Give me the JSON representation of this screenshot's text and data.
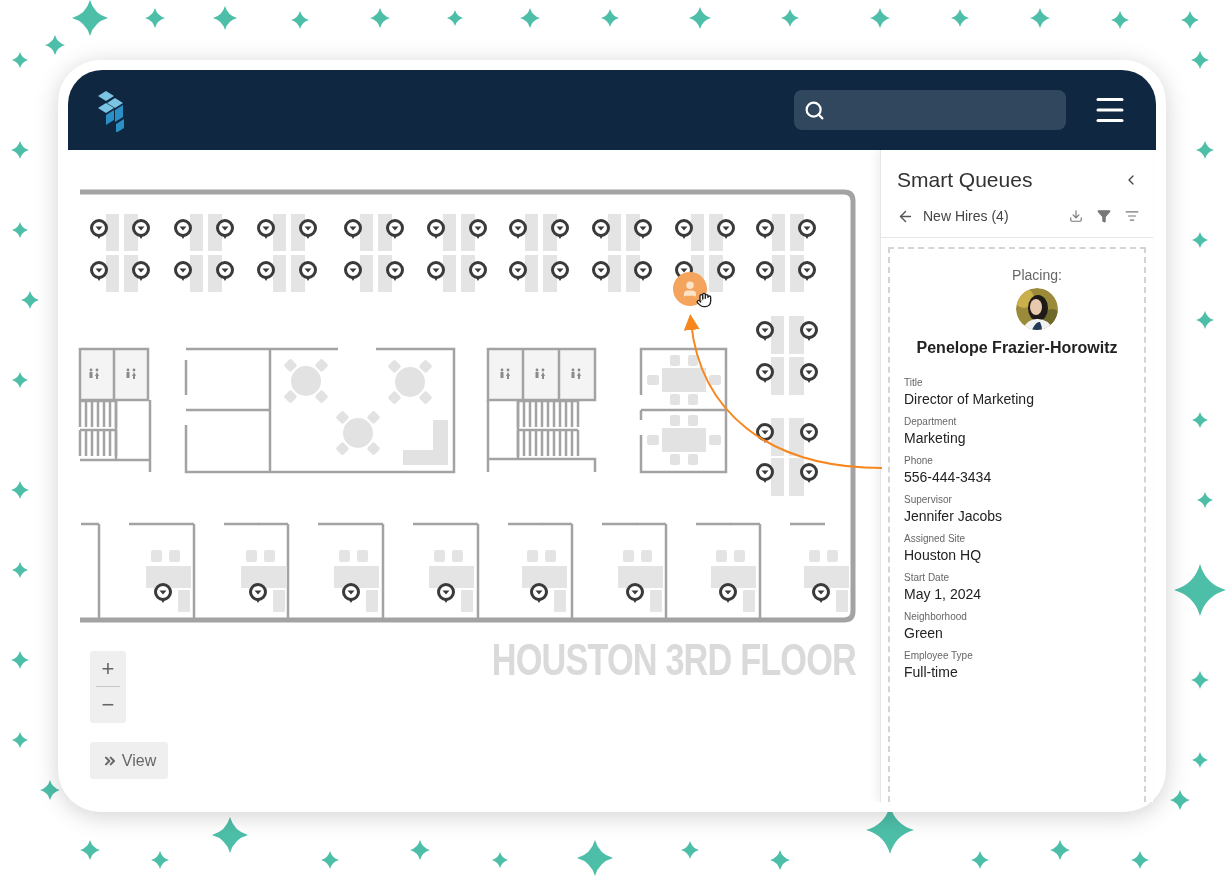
{
  "map": {
    "floor_label": "HOUSTON 3RD FLOOR",
    "zoom_in": "+",
    "zoom_out": "−",
    "view_button": "View"
  },
  "panel": {
    "title": "Smart Queues",
    "queue": "New Hires (4)",
    "placing": {
      "label": "Placing:",
      "name": "Penelope Frazier-Horowitz",
      "fields": [
        {
          "label": "Title",
          "value": "Director of Marketing"
        },
        {
          "label": "Department",
          "value": "Marketing"
        },
        {
          "label": "Phone",
          "value": "556-444-3434"
        },
        {
          "label": "Supervisor",
          "value": "Jennifer Jacobs"
        },
        {
          "label": "Assigned Site",
          "value": "Houston HQ"
        },
        {
          "label": "Start Date",
          "value": "May 1, 2024"
        },
        {
          "label": "Neighborhood",
          "value": "Green"
        },
        {
          "label": "Employee Type",
          "value": "Full-time"
        }
      ]
    }
  }
}
